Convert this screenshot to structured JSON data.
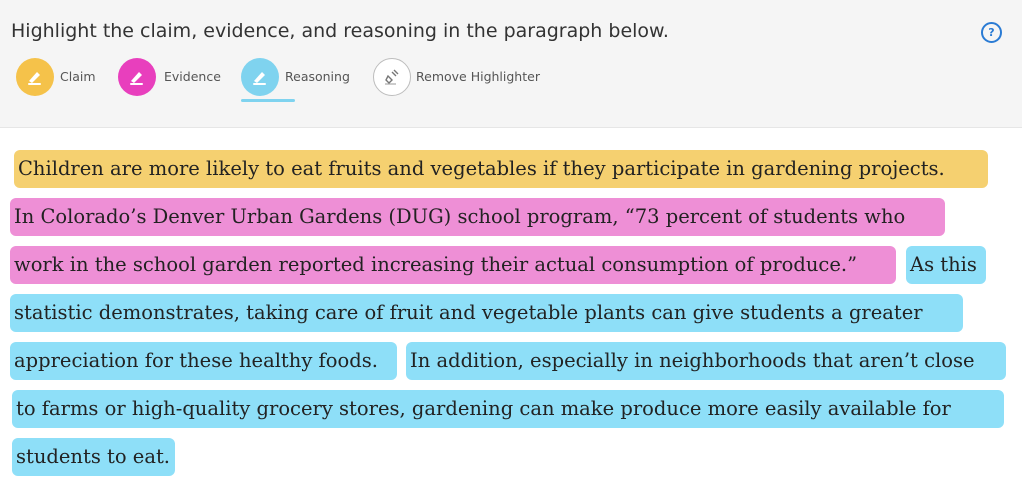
{
  "header": {
    "instruction": "Highlight the claim, evidence, and reasoning in the paragraph below.",
    "help_glyph": "?"
  },
  "tools": [
    {
      "label": "Claim",
      "icon": "highlighter-icon",
      "color": "#f5c24a",
      "selected": false
    },
    {
      "label": "Evidence",
      "icon": "highlighter-icon",
      "color": "#e83fbd",
      "selected": false
    },
    {
      "label": "Reasoning",
      "icon": "highlighter-icon",
      "color": "#7fd3ef",
      "selected": true
    },
    {
      "label": "Remove Highlighter",
      "icon": "eraser-icon",
      "color": "#ffffff",
      "selected": false
    }
  ],
  "highlight_colors": {
    "claim": "#f5d070",
    "evidence": "#ee8fd6",
    "reasoning": "#8edff8"
  },
  "passage": {
    "line1": {
      "claim": "Children are more likely to eat fruits and vegetables if they participate in gardening projects."
    },
    "line2": {
      "evidence": "In Colorado’s Denver Urban Gardens (DUG) school program, “73 percent of students who"
    },
    "line3": {
      "evidence": "work in the school garden reported increasing their actual consumption of produce.”",
      "reasoning": "As this"
    },
    "line4": {
      "reasoning": "statistic demonstrates, taking care of fruit and vegetable plants can give students a greater"
    },
    "line5": {
      "reasoning_a": "appreciation for these healthy foods.",
      "reasoning_b": "In addition, especially in neighborhoods that aren’t close"
    },
    "line6": {
      "reasoning": "to farms or high-quality grocery stores, gardening can make produce more easily available for"
    },
    "line7": {
      "reasoning": "students to eat."
    }
  }
}
